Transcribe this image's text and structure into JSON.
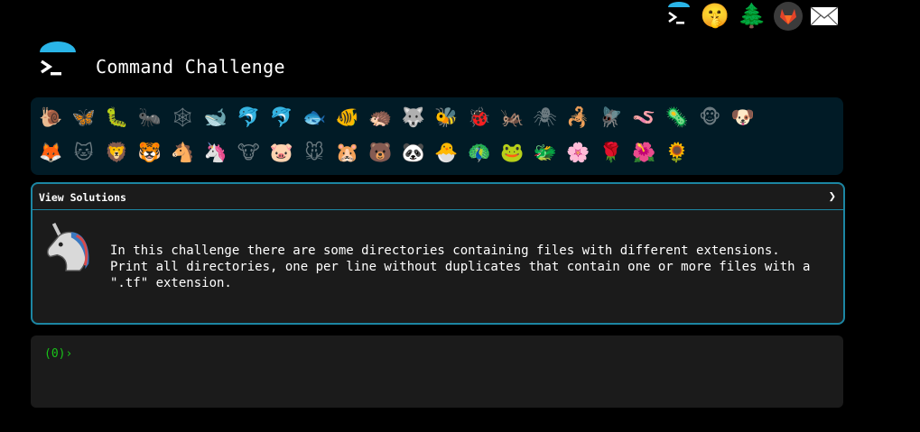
{
  "header": {
    "title": "Command Challenge",
    "icons": [
      "terminal-icon",
      "shush-face-icon",
      "tree-icon",
      "gitlab-icon",
      "mail-icon"
    ]
  },
  "animals": {
    "row1": [
      "🐌",
      "🦋",
      "🐛",
      "🐜",
      "🕸",
      "🐋",
      "🐬",
      "🐬",
      "🐟",
      "🐠",
      "🦔",
      "🐺",
      "🐝",
      "🐞",
      "🦗",
      "🕷",
      "🦂",
      "🪰",
      "🪱",
      "🦠",
      "🐵",
      "🐶"
    ],
    "row2": [
      "🦊",
      "🐱",
      "🦁",
      "🐯",
      "🐴",
      "🦄",
      "🐮",
      "🐷",
      "🐭",
      "🐹",
      "🐻",
      "🐼",
      "🐣",
      "🦚",
      "🐸",
      "🐲",
      "🌸",
      "🌹",
      "🌺",
      "🌻"
    ],
    "current_index_row2": 5
  },
  "panel": {
    "view_solutions": "View Solutions",
    "chevron": "❯",
    "description": "In this challenge there are some directories containing files with different extensions.\nPrint all directories, one per line without duplicates that contain one or more files with a\n\".tf\" extension."
  },
  "terminal": {
    "prompt": "(0)›",
    "input_value": ""
  },
  "colors": {
    "accent": "#1c86a3",
    "strip_bg": "#011b26",
    "panel_bg": "#1b1b1b",
    "prompt_green": "#19c419"
  }
}
